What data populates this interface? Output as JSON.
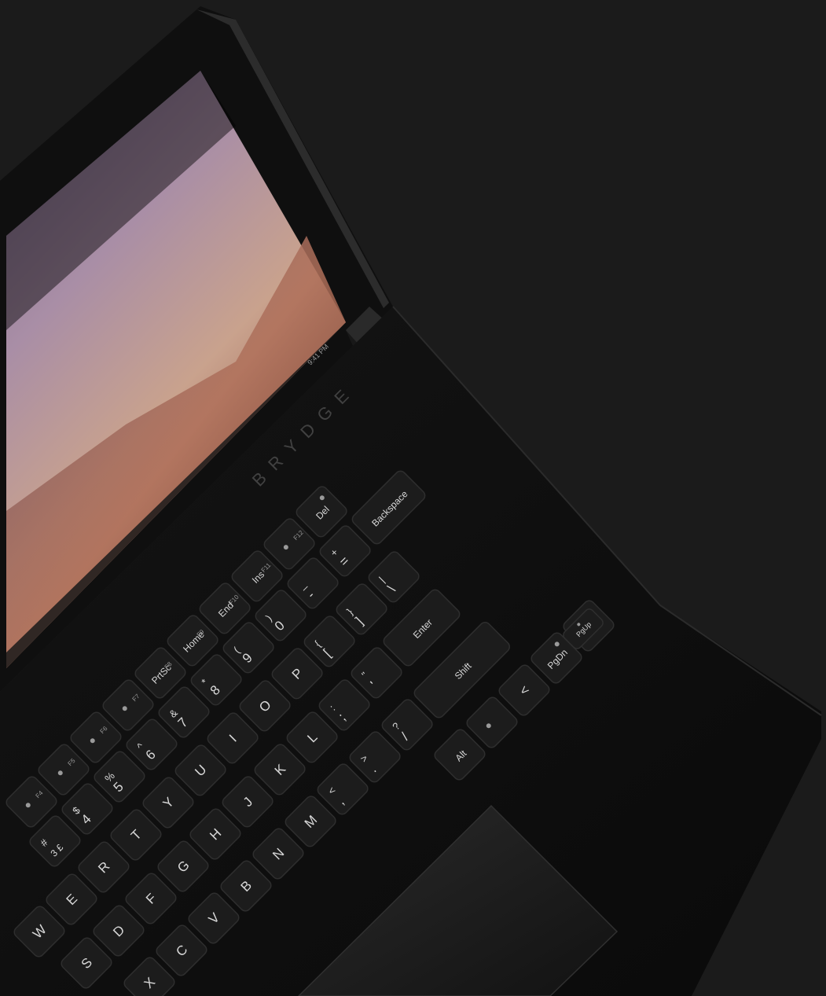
{
  "photo": {
    "subject": "laptop",
    "background_color": "#1b1b1b",
    "body_color": "#0d0d0d"
  },
  "screen": {
    "wallpaper_colors": [
      "#7c6a8e",
      "#a98ea6",
      "#c9a28d",
      "#8a4a3a"
    ],
    "taskbar_clock": "9:41 PM"
  },
  "brand_mark": "BRYDGE",
  "keyboard": {
    "rows": [
      [
        {
          "main": "",
          "fn": "F4",
          "icon": "mute-icon"
        },
        {
          "main": "",
          "fn": "F5",
          "icon": "volume-down-icon"
        },
        {
          "main": "",
          "fn": "F6",
          "icon": "volume-up-icon"
        },
        {
          "main": "",
          "fn": "F7",
          "icon": "brightness-icon"
        },
        {
          "main": "PrtSc",
          "fn": "F8"
        },
        {
          "main": "Home",
          "fn": "F9"
        },
        {
          "main": "End",
          "fn": "F10"
        },
        {
          "main": "Ins",
          "fn": "F11"
        },
        {
          "main": "",
          "fn": "F12",
          "icon": "bluetooth-icon"
        },
        {
          "main": "Del",
          "fn": "",
          "icon": "power-icon"
        }
      ],
      [
        {
          "main": "3 £",
          "shift": "#"
        },
        {
          "main": "4",
          "shift": "$"
        },
        {
          "main": "5",
          "shift": "%"
        },
        {
          "main": "6",
          "shift": "^"
        },
        {
          "main": "7",
          "shift": "&"
        },
        {
          "main": "8",
          "shift": "*"
        },
        {
          "main": "9",
          "shift": "("
        },
        {
          "main": "0",
          "shift": ")"
        },
        {
          "main": "-",
          "shift": "_"
        },
        {
          "main": "=",
          "shift": "+"
        },
        {
          "main": "Backspace",
          "shift": ""
        }
      ],
      [
        {
          "main": "W"
        },
        {
          "main": "E"
        },
        {
          "main": "R"
        },
        {
          "main": "T"
        },
        {
          "main": "Y"
        },
        {
          "main": "U"
        },
        {
          "main": "I"
        },
        {
          "main": "O"
        },
        {
          "main": "P"
        },
        {
          "main": "[",
          "shift": "{"
        },
        {
          "main": "]",
          "shift": "}"
        },
        {
          "main": "\\",
          "shift": "|"
        }
      ],
      [
        {
          "main": "S"
        },
        {
          "main": "D"
        },
        {
          "main": "F"
        },
        {
          "main": "G"
        },
        {
          "main": "H"
        },
        {
          "main": "J"
        },
        {
          "main": "K"
        },
        {
          "main": "L"
        },
        {
          "main": ";",
          "shift": ":"
        },
        {
          "main": "'",
          "shift": "\""
        },
        {
          "main": "Enter"
        }
      ],
      [
        {
          "main": "X"
        },
        {
          "main": "C"
        },
        {
          "main": "V"
        },
        {
          "main": "B"
        },
        {
          "main": "N"
        },
        {
          "main": "M"
        },
        {
          "main": ",",
          "shift": "<"
        },
        {
          "main": ".",
          "shift": ">"
        },
        {
          "main": "/",
          "shift": "?"
        },
        {
          "main": "Shift"
        }
      ],
      [
        {
          "main": "Alt"
        },
        {
          "main": "",
          "icon": "menu-icon"
        },
        {
          "main": "<"
        },
        {
          "main": "PgDn",
          "icon": "down-arrow-icon"
        },
        {
          "main": ">"
        }
      ]
    ],
    "extra_keys": [
      {
        "main": "PgUp",
        "icon": "up-arrow-icon"
      }
    ]
  }
}
